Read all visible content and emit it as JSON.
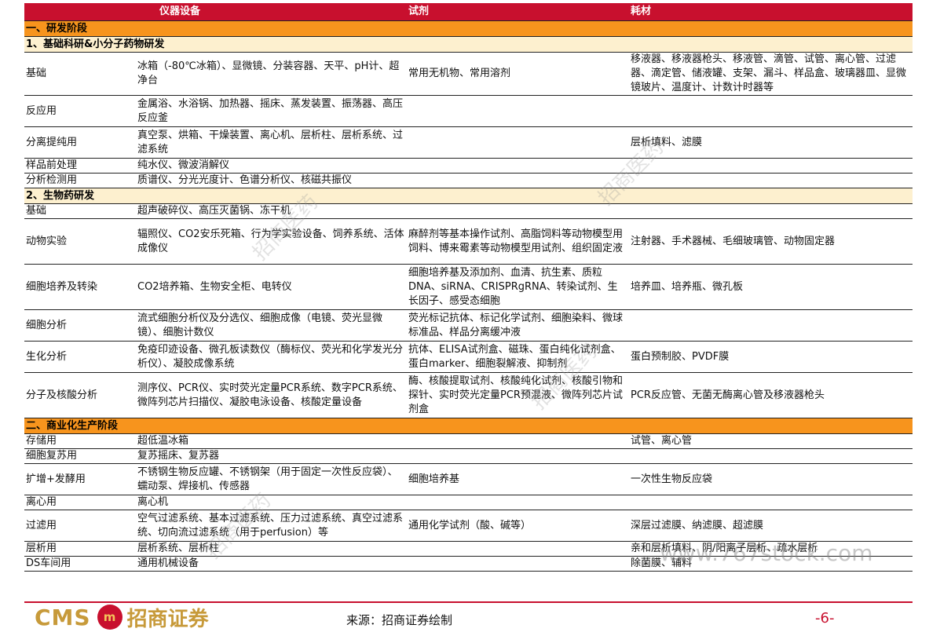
{
  "header": {
    "col1": "",
    "col2": "仪器设备",
    "col3": "试剂",
    "col4": "耗材"
  },
  "sections": {
    "s1": "一、研发阶段",
    "s1a": "1、基础科研&小分子药物研发",
    "s1b": "2、生物药研发",
    "s2": "二、商业化生产阶段"
  },
  "rows1a": [
    {
      "name": "基础",
      "equipment": "冰箱（-80℃冰箱）、显微镜、分装容器、天平、pH计、超净台",
      "reagent": "常用无机物、常用溶剂",
      "consumable": "移液器、移液器枪头、移液管、滴管、试管、离心管、过滤器、滴定管、储液罐、支架、漏斗、样品盒、玻璃器皿、显微镜玻片、温度计、计数计时器等"
    },
    {
      "name": "反应用",
      "equipment": "金属浴、水浴锅、加热器、摇床、蒸发装置、振荡器、高压反应釜",
      "reagent": "",
      "consumable": ""
    },
    {
      "name": "分离提纯用",
      "equipment": "真空泵、烘箱、干燥装置、离心机、层析柱、层析系统、过滤系统",
      "reagent": "",
      "consumable": "层析填料、滤膜"
    },
    {
      "name": "样品前处理",
      "equipment": "纯水仪、微波消解仪",
      "reagent": "",
      "consumable": ""
    },
    {
      "name": "分析检测用",
      "equipment": "质谱仪、分光光度计、色谱分析仪、核磁共振仪",
      "reagent": "",
      "consumable": ""
    }
  ],
  "rows1b": [
    {
      "name": "基础",
      "equipment": "超声破碎仪、高压灭菌锅、冻干机",
      "reagent": "",
      "consumable": ""
    },
    {
      "name": "动物实验",
      "equipment": "辐照仪、CO2安乐死箱、行为学实验设备、饲养系统、活体成像仪",
      "reagent": "麻醉剂等基本操作试剂、高脂饲料等动物模型用饲料、博来霉素等动物模型用试剂、组织固定液",
      "consumable": "注射器、手术器械、毛细玻璃管、动物固定器"
    },
    {
      "name": "细胞培养及转染",
      "equipment": "CO2培养箱、生物安全柜、电转仪",
      "reagent": "细胞培养基及添加剂、血清、抗生素、质粒DNA、siRNA、CRISPRgRNA、转染试剂、生长因子、感受态细胞",
      "consumable": "培养皿、培养瓶、微孔板"
    },
    {
      "name": "细胞分析",
      "equipment": "流式细胞分析仪及分选仪、细胞成像（电镜、荧光显微镜）、细胞计数仪",
      "reagent": "荧光标记抗体、标记化学试剂、细胞染料、微球标准品、样品分离缓冲液",
      "consumable": ""
    },
    {
      "name": "生化分析",
      "equipment": "免疫印迹设备、微孔板读数仪（酶标仪、荧光和化学发光分析仪）、凝胶成像系统",
      "reagent": "抗体、ELISA试剂盒、磁珠、蛋白纯化试剂盒、蛋白marker、细胞裂解液、抑制剂",
      "consumable": "蛋白预制胶、PVDF膜"
    },
    {
      "name": "分子及核酸分析",
      "equipment": "测序仪、PCR仪、实时荧光定量PCR系统、数字PCR系统、微阵列芯片扫描仪、凝胶电泳设备、核酸定量设备",
      "reagent": "酶、核酸提取试剂、核酸纯化试剂、核酸引物和探针、实时荧光定量PCR预混液、微阵列芯片试剂盒",
      "consumable": "PCR反应管、无菌无酶离心管及移液器枪头"
    }
  ],
  "rows2": [
    {
      "name": "存储用",
      "equipment": "超低温冰箱",
      "reagent": "",
      "consumable": "试管、离心管"
    },
    {
      "name": "细胞复苏用",
      "equipment": "复苏摇床、复苏器",
      "reagent": "",
      "consumable": ""
    },
    {
      "name": "扩增+发酵用",
      "equipment": "不锈钢生物反应罐、不锈钢架（用于固定一次性反应袋）、蠕动泵、焊接机、传感器",
      "reagent": "细胞培养基",
      "consumable": "一次性生物反应袋"
    },
    {
      "name": "离心用",
      "equipment": "离心机",
      "reagent": "",
      "consumable": ""
    },
    {
      "name": "过滤用",
      "equipment": "空气过滤系统、基本过滤系统、压力过滤系统、真空过滤系统、切向流过滤系统（用于perfusion）等",
      "reagent": "通用化学试剂（酸、碱等）",
      "consumable": "深层过滤膜、纳滤膜、超滤膜"
    },
    {
      "name": "层析用",
      "equipment": "层析系统、层析柱",
      "reagent": "",
      "consumable": "亲和层析填料、阴/阳离子层析、疏水层析"
    },
    {
      "name": "DS车间用",
      "equipment": "通用机械设备",
      "reagent": "",
      "consumable": "除菌膜、辅料"
    }
  ],
  "footer": {
    "logo_text": "CMS",
    "logo_emblem": "m",
    "logo_cn": "招商证券",
    "source": "来源：招商证券绘制",
    "page": "-6-",
    "website": "www.767stock.com",
    "watermark": "招商医药"
  }
}
